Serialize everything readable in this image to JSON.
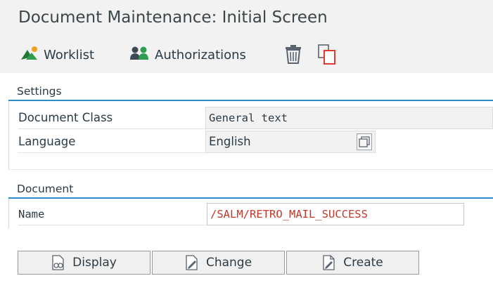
{
  "window": {
    "title": "Document Maintenance: Initial Screen"
  },
  "toolbar": {
    "worklist_label": "Worklist",
    "authorizations_label": "Authorizations"
  },
  "settings": {
    "heading": "Settings",
    "document_class_label": "Document Class",
    "document_class_value": "General text",
    "language_label": "Language",
    "language_value": "English"
  },
  "document": {
    "heading": "Document",
    "name_label": "Name",
    "name_value": "/SALM/RETRO_MAIL_SUCCESS"
  },
  "actions": {
    "display_label": "Display",
    "change_label": "Change",
    "create_label": "Create"
  },
  "colors": {
    "accent": "#2e8bc9",
    "name_value": "#c0392b",
    "delete_icon": "#e23a2c"
  }
}
